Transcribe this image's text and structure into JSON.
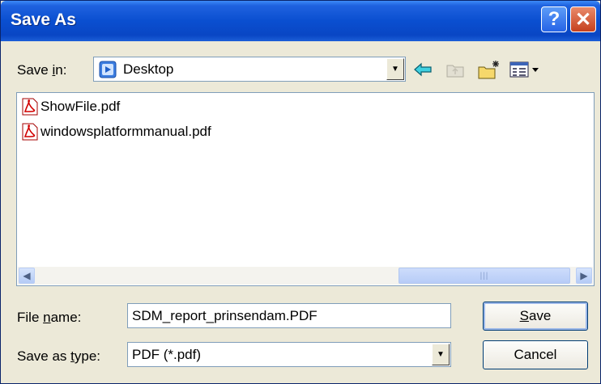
{
  "window": {
    "title": "Save As"
  },
  "title_buttons": {
    "help": "?",
    "close": "✕"
  },
  "save_in": {
    "label_pre": "Save ",
    "label_key": "i",
    "label_post": "n:",
    "value": "Desktop"
  },
  "files": [
    {
      "name": "ShowFile.pdf"
    },
    {
      "name": "windowsplatformmanual.pdf"
    }
  ],
  "file_name": {
    "label_pre": "File ",
    "label_key": "n",
    "label_post": "ame:",
    "value": "SDM_report_prinsendam.PDF"
  },
  "save_type": {
    "label_pre": "Save as ",
    "label_key": "t",
    "label_post": "ype:",
    "value": "PDF (*.pdf)"
  },
  "buttons": {
    "save_key": "S",
    "save_rest": "ave",
    "cancel": "Cancel"
  },
  "icons": {
    "back": "back-arrow-icon",
    "up": "up-folder-icon",
    "new_folder": "new-folder-icon",
    "views": "views-menu-icon",
    "pdf": "pdf-file-icon"
  }
}
